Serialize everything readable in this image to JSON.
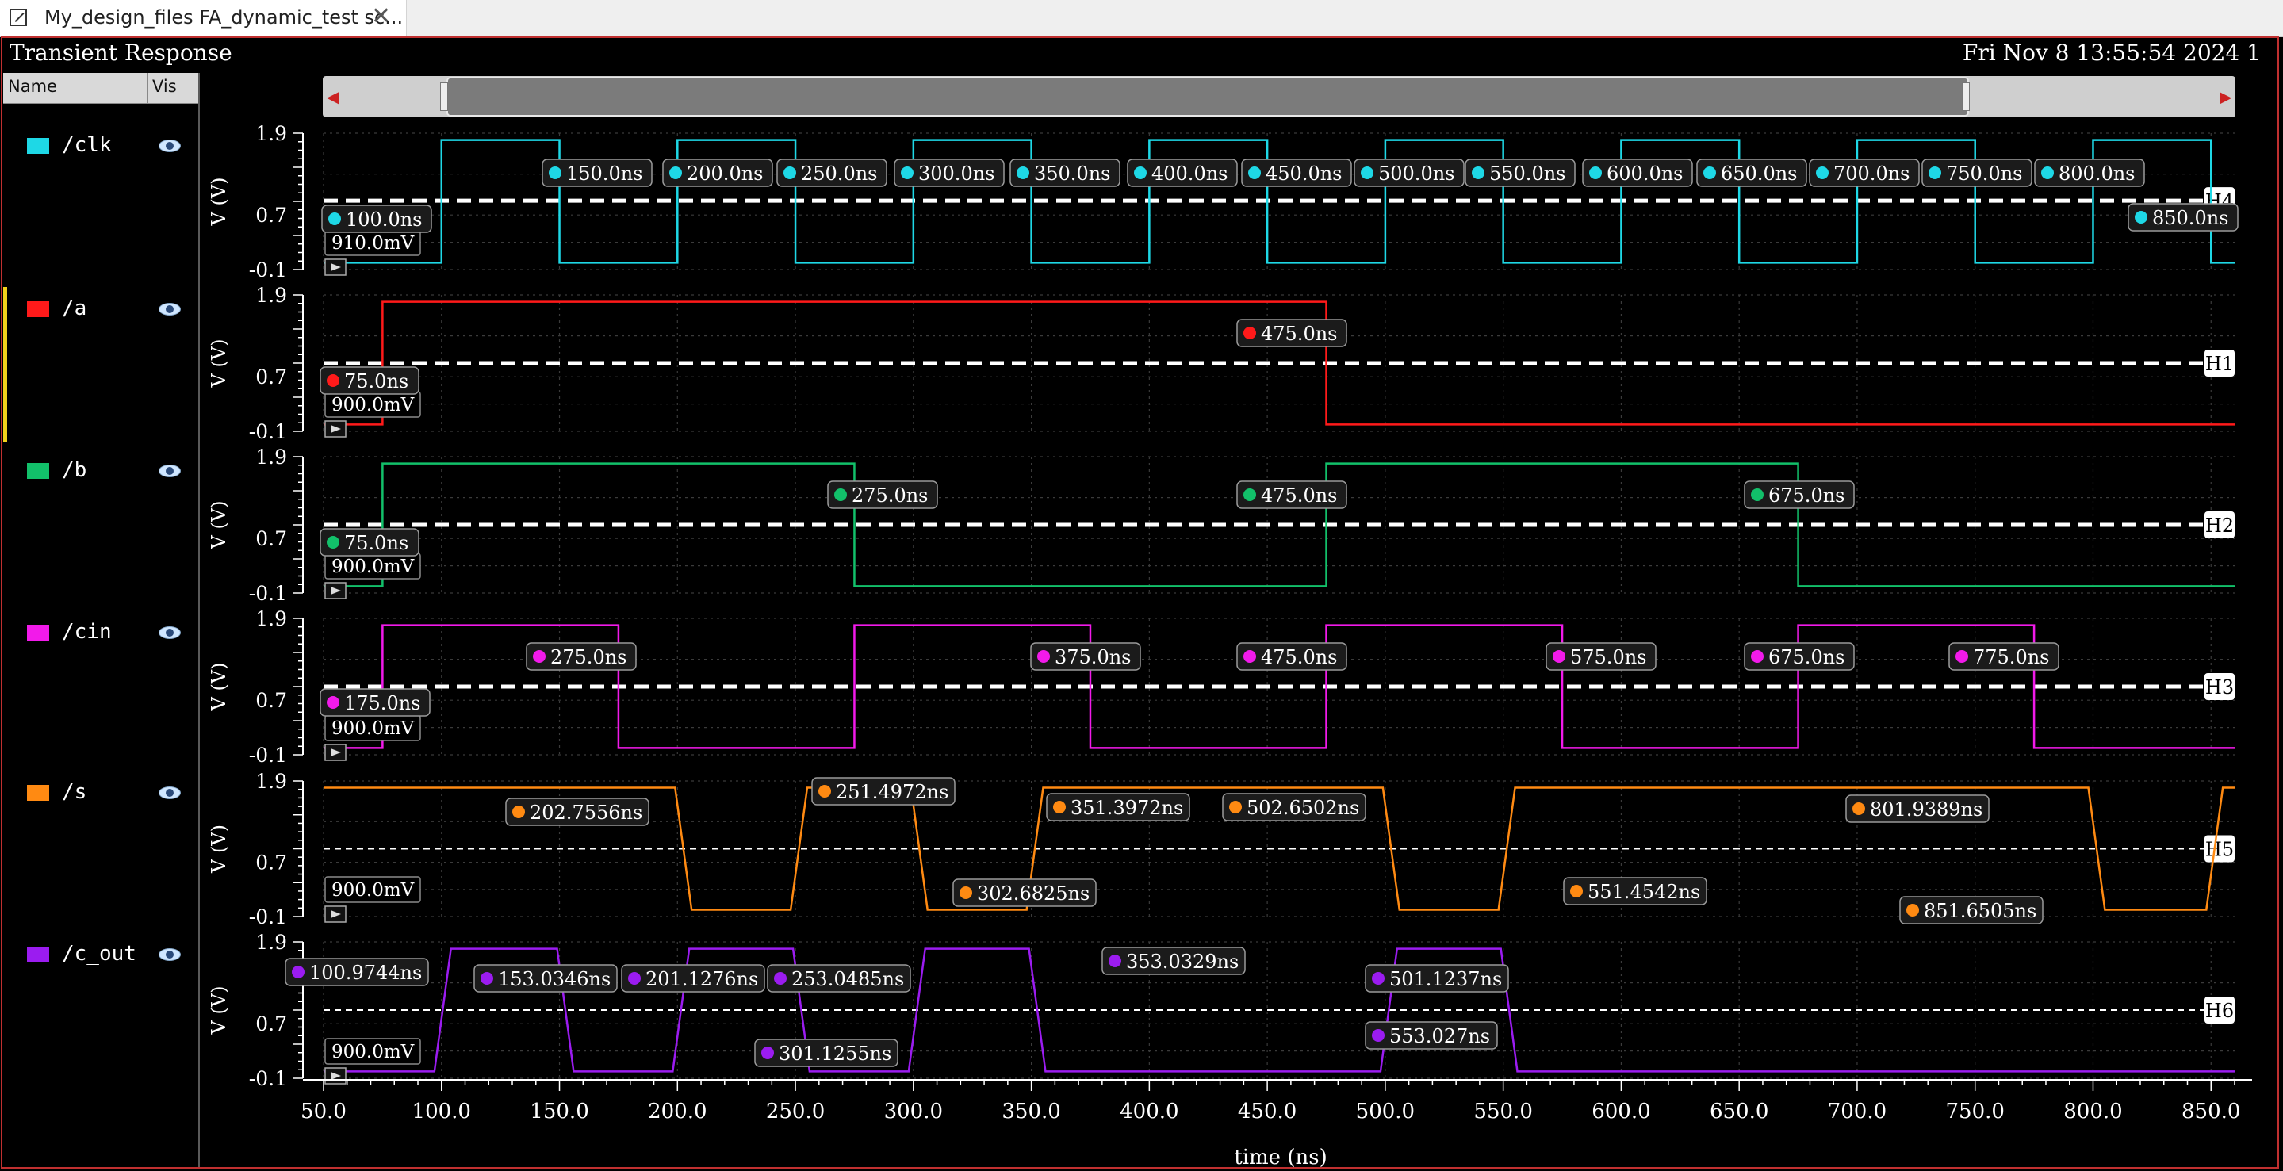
{
  "tab": {
    "title": "My_design_files FA_dynamic_test sc...",
    "close_glyph": "✕",
    "icon": "window-icon"
  },
  "window": {
    "title": "Transient Response",
    "datetime": "Fri Nov 8 13:55:54 2024  1"
  },
  "legend": {
    "header_name": "Name",
    "header_vis": "Vis",
    "items": [
      {
        "label": "/clk",
        "color": "#1ed8e6"
      },
      {
        "label": "/a",
        "color": "#ff1a1a"
      },
      {
        "label": "/b",
        "color": "#12c06a"
      },
      {
        "label": "/cin",
        "color": "#f21aea"
      },
      {
        "label": "/s",
        "color": "#ff8a12"
      },
      {
        "label": "/c_out",
        "color": "#9b1cf0"
      }
    ]
  },
  "chart_data": {
    "type": "line",
    "xlabel": "time (ns)",
    "xlim": [
      50,
      860
    ],
    "x_ticks": [
      "50.0",
      "100.0",
      "150.0",
      "200.0",
      "250.0",
      "300.0",
      "350.0",
      "400.0",
      "450.0",
      "500.0",
      "550.0",
      "600.0",
      "650.0",
      "700.0",
      "750.0",
      "800.0",
      "850.0"
    ],
    "ylim": [
      -0.1,
      1.9
    ],
    "y_ticks": [
      "1.9",
      "0.7",
      "-0.1"
    ],
    "ylabel": "V (V)",
    "grid": true,
    "series": [
      {
        "name": "/clk",
        "color": "#1ed8e6",
        "marker": "H4",
        "level_label": "910.0mV",
        "level": 0.91,
        "thick": true,
        "points": [
          [
            50,
            0
          ],
          [
            100,
            0
          ],
          [
            100,
            1.8
          ],
          [
            150,
            1.8
          ],
          [
            150,
            0
          ],
          [
            200,
            0
          ],
          [
            200,
            1.8
          ],
          [
            250,
            1.8
          ],
          [
            250,
            0
          ],
          [
            300,
            0
          ],
          [
            300,
            1.8
          ],
          [
            350,
            1.8
          ],
          [
            350,
            0
          ],
          [
            400,
            0
          ],
          [
            400,
            1.8
          ],
          [
            450,
            1.8
          ],
          [
            450,
            0
          ],
          [
            500,
            0
          ],
          [
            500,
            1.8
          ],
          [
            550,
            1.8
          ],
          [
            550,
            0
          ],
          [
            600,
            0
          ],
          [
            600,
            1.8
          ],
          [
            650,
            1.8
          ],
          [
            650,
            0
          ],
          [
            700,
            0
          ],
          [
            700,
            1.8
          ],
          [
            750,
            1.8
          ],
          [
            750,
            0
          ],
          [
            800,
            0
          ],
          [
            800,
            1.8
          ],
          [
            850,
            1.8
          ],
          [
            850,
            0
          ],
          [
            860,
            0
          ]
        ],
        "callouts": [
          "100.0ns",
          "150.0ns",
          "200.0ns",
          "250.0ns",
          "300.0ns",
          "350.0ns",
          "400.0ns",
          "450.0ns",
          "500.0ns",
          "550.0ns",
          "600.0ns",
          "650.0ns",
          "700.0ns",
          "750.0ns",
          "800.0ns",
          "850.0ns"
        ]
      },
      {
        "name": "/a",
        "color": "#ff1a1a",
        "marker": "H1",
        "level_label": "900.0mV",
        "level": 0.9,
        "thick": true,
        "points": [
          [
            50,
            0
          ],
          [
            75,
            0
          ],
          [
            75,
            1.8
          ],
          [
            475,
            1.8
          ],
          [
            475,
            0
          ],
          [
            860,
            0
          ]
        ],
        "callouts": [
          "75.0ns",
          "475.0ns"
        ]
      },
      {
        "name": "/b",
        "color": "#12c06a",
        "marker": "H2",
        "level_label": "900.0mV",
        "level": 0.9,
        "thick": true,
        "points": [
          [
            50,
            0
          ],
          [
            75,
            0
          ],
          [
            75,
            1.8
          ],
          [
            275,
            1.8
          ],
          [
            275,
            0
          ],
          [
            475,
            0
          ],
          [
            475,
            1.8
          ],
          [
            675,
            1.8
          ],
          [
            675,
            0
          ],
          [
            860,
            0
          ]
        ],
        "callouts": [
          "75.0ns",
          "275.0ns",
          "475.0ns",
          "675.0ns"
        ]
      },
      {
        "name": "/cin",
        "color": "#f21aea",
        "marker": "H3",
        "level_label": "900.0mV",
        "level": 0.9,
        "thick": true,
        "points": [
          [
            50,
            0
          ],
          [
            75,
            0
          ],
          [
            75,
            1.8
          ],
          [
            175,
            1.8
          ],
          [
            175,
            0
          ],
          [
            275,
            0
          ],
          [
            275,
            1.8
          ],
          [
            375,
            1.8
          ],
          [
            375,
            0
          ],
          [
            475,
            0
          ],
          [
            475,
            1.8
          ],
          [
            575,
            1.8
          ],
          [
            575,
            0
          ],
          [
            675,
            0
          ],
          [
            675,
            1.8
          ],
          [
            775,
            1.8
          ],
          [
            775,
            0
          ],
          [
            860,
            0
          ]
        ],
        "callouts": [
          "75.0ns",
          "175.0ns",
          "275.0ns",
          "375.0ns",
          "475.0ns",
          "575.0ns",
          "675.0ns",
          "775.0ns"
        ]
      },
      {
        "name": "/s",
        "color": "#ff8a12",
        "marker": "H5",
        "level_label": "900.0mV",
        "level": 0.9,
        "thick": false,
        "points": [
          [
            50,
            1.8
          ],
          [
            199,
            1.8
          ],
          [
            206,
            0
          ],
          [
            248,
            0
          ],
          [
            255,
            1.8
          ],
          [
            299,
            1.8
          ],
          [
            306,
            0
          ],
          [
            348,
            0
          ],
          [
            355,
            1.8
          ],
          [
            499,
            1.8
          ],
          [
            506,
            0
          ],
          [
            548,
            0
          ],
          [
            555,
            1.8
          ],
          [
            798,
            1.8
          ],
          [
            805,
            0
          ],
          [
            848,
            0
          ],
          [
            855,
            1.8
          ],
          [
            860,
            1.8
          ]
        ],
        "callouts": [
          "202.7556ns",
          "251.4972ns",
          "302.6825ns",
          "351.3972ns",
          "502.6502ns",
          "551.4542ns",
          "801.9389ns",
          "851.6505ns"
        ]
      },
      {
        "name": "/c_out",
        "color": "#9b1cf0",
        "marker": "H6",
        "level_label": "900.0mV",
        "level": 0.9,
        "thick": false,
        "points": [
          [
            50,
            0
          ],
          [
            97,
            0
          ],
          [
            104,
            1.8
          ],
          [
            149,
            1.8
          ],
          [
            156,
            0
          ],
          [
            198,
            0
          ],
          [
            205,
            1.8
          ],
          [
            249,
            1.8
          ],
          [
            256,
            0
          ],
          [
            298,
            0
          ],
          [
            305,
            1.8
          ],
          [
            349,
            1.8
          ],
          [
            356,
            0
          ],
          [
            498,
            0
          ],
          [
            505,
            1.8
          ],
          [
            549,
            1.8
          ],
          [
            556,
            0
          ],
          [
            860,
            0
          ]
        ],
        "callouts": [
          "100.9744ns",
          "153.0346ns",
          "201.1276ns",
          "253.0485ns",
          "301.1255ns",
          "353.0329ns",
          "501.1237ns",
          "553.027ns"
        ]
      }
    ]
  }
}
